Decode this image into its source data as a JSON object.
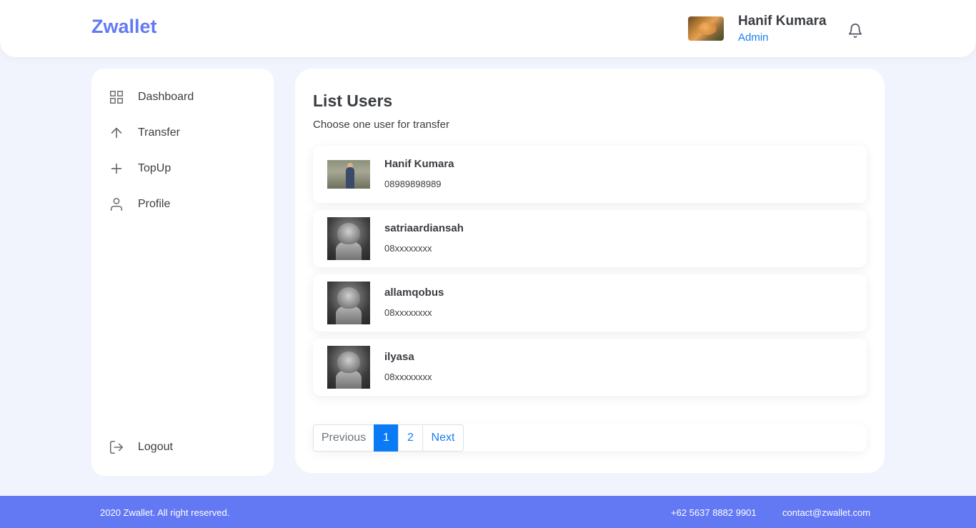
{
  "header": {
    "brand": "Zwallet",
    "user_name": "Hanif Kumara",
    "user_role": "Admin",
    "avatar_icon": "cat-photo-avatar",
    "notification_icon": "bell-icon"
  },
  "sidebar": {
    "items": [
      {
        "label": "Dashboard",
        "icon": "grid-icon"
      },
      {
        "label": "Transfer",
        "icon": "arrow-up-icon"
      },
      {
        "label": "TopUp",
        "icon": "plus-icon"
      },
      {
        "label": "Profile",
        "icon": "user-icon"
      }
    ],
    "logout": {
      "label": "Logout",
      "icon": "logout-icon"
    }
  },
  "main": {
    "title": "List Users",
    "subtitle": "Choose one user for transfer",
    "users": [
      {
        "name": "Hanif Kumara",
        "phone": "08989898989",
        "photo": "person-photo"
      },
      {
        "name": "satriaardiansah",
        "phone": "08xxxxxxxx",
        "photo": "cat-photo"
      },
      {
        "name": "allamqobus",
        "phone": "08xxxxxxxx",
        "photo": "cat-photo"
      },
      {
        "name": "ilyasa",
        "phone": "08xxxxxxxx",
        "photo": "cat-photo"
      }
    ],
    "pagination": {
      "previous": "Previous",
      "pages": [
        "1",
        "2"
      ],
      "current": "1",
      "next": "Next"
    }
  },
  "footer": {
    "copyright": "2020 Zwallet. All right reserved.",
    "phone": "+62 5637 8882 9901",
    "email": "contact@zwallet.com"
  },
  "colors": {
    "brand": "#6379f4",
    "accent_blue": "#1a7df0",
    "page_background": "#f1f4fd"
  }
}
